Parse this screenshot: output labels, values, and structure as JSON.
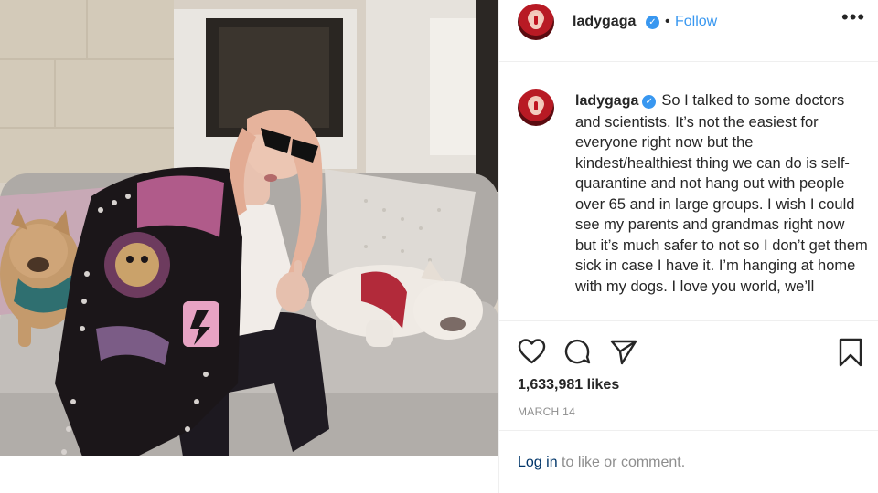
{
  "post": {
    "username": "ladygaga",
    "verified_glyph": "✓",
    "separator": "•",
    "follow_label": "Follow",
    "more_label": "•••",
    "caption": "So I talked to some doctors and scientists. It’s not the easiest for everyone right now but the kindest/healthiest thing we can do is self-quarantine and not hang out with people over 65 and in large groups. I wish I could see my parents and grandmas right now but it’s much safer to not so I don’t get them sick in case I have it. I’m hanging at home with my dogs. I love you world, we’ll",
    "likes": "1,633,981 likes",
    "date": "MARCH 14"
  },
  "actions": {
    "like_icon": "heart-icon",
    "comment_icon": "comment-icon",
    "share_icon": "share-icon",
    "save_icon": "bookmark-icon"
  },
  "footer": {
    "login_link": "Log in",
    "login_rest": " to like or comment."
  },
  "photo": {
    "description_colors": {
      "wall": "#d8d0c5",
      "sofa": "#b9b6b3",
      "pillow": "#d9d5d0",
      "pink_pillow": "#c9a8b8",
      "jacket": "#1b1619",
      "hair": "#e8b39a"
    }
  },
  "colors": {
    "accent": "#3897f0",
    "text": "#262626",
    "muted": "#8e8e8e",
    "link_dark": "#003569",
    "border": "#efefef"
  }
}
